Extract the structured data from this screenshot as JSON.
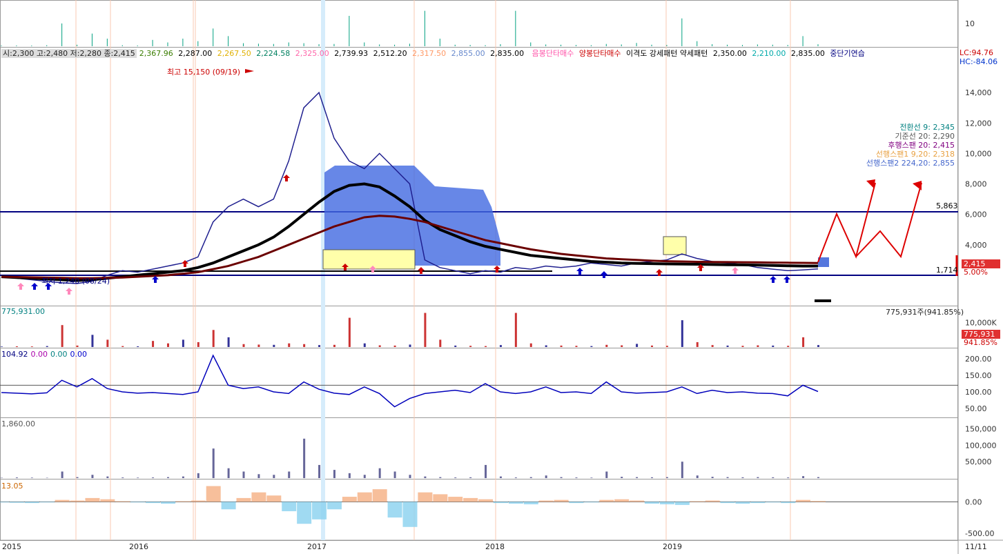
{
  "main_header": {
    "ohlc": "시:2,300 고:2,480 저:2,280 종:2,415",
    "ma_values": [
      {
        "text": "2,367.96",
        "color": "#3a7d00"
      },
      {
        "text": "2,287.00",
        "color": "#000000"
      },
      {
        "text": "2,267.50",
        "color": "#e0b000"
      },
      {
        "text": "2,224.58",
        "color": "#008060"
      },
      {
        "text": "2,325.00",
        "color": "#ff66aa"
      },
      {
        "text": "2,739.93",
        "color": "#000000"
      },
      {
        "text": "2,512.20",
        "color": "#000000"
      },
      {
        "text": "2,317.50",
        "color": "#ff9966"
      },
      {
        "text": "2,855.00",
        "color": "#6688cc"
      },
      {
        "text": "2,835.00",
        "color": "#000000"
      }
    ],
    "signals": [
      {
        "text": "음봉단타매수",
        "color": "#ff55aa"
      },
      {
        "text": "양봉단타매수",
        "color": "#cc0000"
      },
      {
        "text": "이격도 강세패턴 약세패턴",
        "color": "#000000"
      },
      {
        "text": "2,350.00",
        "color": "#000000"
      },
      {
        "text": "2,210.00",
        "color": "#00aaaa"
      },
      {
        "text": "2,835.00",
        "color": "#000000"
      },
      {
        "text": "중단기연습",
        "color": "#000080"
      }
    ],
    "lc": "LC:94.76",
    "hc": "HC:-84.06"
  },
  "annotations": {
    "high": "최고 15,150 (09/19)",
    "low": "최저 1,240 (08/24)",
    "line_upper": "5,863",
    "line_lower": "1,714",
    "last_price": "2,415",
    "pct": "5.00%"
  },
  "ichimoku_legend": [
    {
      "text": "전환선 9: 2,345",
      "color": "#008080"
    },
    {
      "text": "기준선 20: 2,290",
      "color": "#555555"
    },
    {
      "text": "후행스팬 20: 2,415",
      "color": "#800080"
    },
    {
      "text": "선행스팬1 9,20: 2,318",
      "color": "#e8a040"
    },
    {
      "text": "선행스팬2 224,20: 2,855",
      "color": "#4466cc"
    }
  ],
  "volume_panel": {
    "label": "775,931.00",
    "right_label": "775,931주(941.85%)",
    "tag_value": "775,931",
    "tag_pct": "941.85%"
  },
  "disparity_panel": {
    "label_a": "104.92",
    "label_b": "0.00",
    "label_c": "0.00",
    "label_d": "0.00"
  },
  "amount_panel": {
    "label": "1,860.00"
  },
  "osc_panel": {
    "label": "13.05"
  },
  "x_axis": {
    "labels": [
      "2015",
      "2016",
      "2017",
      "2018",
      "2019",
      "11/11"
    ]
  },
  "colors": {
    "cloud": "#4169e1",
    "price_line": "#1f1f8f",
    "ma_long": "#000000",
    "ma_vlong": "#6b0000",
    "hline": "#000080",
    "up": "#cc0000",
    "down": "#0000cc"
  },
  "chart_data": [
    {
      "type": "line",
      "title": "",
      "ylim": [
        0,
        16000
      ],
      "y_ticks": [
        4000,
        6000,
        8000,
        10000,
        12000,
        14000
      ],
      "y_tick_labels": [
        "4,000",
        "6,000",
        "8,000",
        "10,000",
        "12,000",
        "14,000"
      ],
      "x_labels": [
        "2015",
        "2016",
        "2017",
        "2018",
        "2019"
      ],
      "series": [
        {
          "values": [
            1900,
            1800,
            1700,
            1600,
            1500,
            1450,
            1600,
            2000,
            2300,
            2200,
            2400,
            2600,
            2800,
            3200,
            5500,
            6500,
            7000,
            6500,
            7000,
            9500,
            13000,
            14000,
            11000,
            9500,
            9000,
            10000,
            9000,
            8000,
            3000,
            2500,
            2300,
            2100,
            2300,
            2200,
            2500,
            2400,
            2600,
            2500,
            2600,
            2800,
            2700,
            2600,
            2800,
            2900,
            3000,
            3400,
            3100,
            2900,
            2800,
            2700,
            2500,
            2400,
            2300,
            2350,
            2415
          ]
        },
        {
          "values": [
            1900,
            1850,
            1800,
            1750,
            1700,
            1650,
            1700,
            1800,
            1900,
            2000,
            2100,
            2200,
            2300,
            2500,
            2800,
            3200,
            3600,
            4000,
            4500,
            5200,
            6000,
            6800,
            7500,
            7900,
            8000,
            7800,
            7200,
            6500,
            5600,
            5000,
            4600,
            4200,
            3900,
            3700,
            3500,
            3300,
            3200,
            3100,
            3000,
            2900,
            2850,
            2800,
            2780,
            2760,
            2740,
            2730,
            2720,
            2700,
            2690,
            2680,
            2660,
            2640,
            2620,
            2600,
            2600
          ]
        },
        {
          "values": [
            1900,
            1880,
            1860,
            1840,
            1820,
            1800,
            1800,
            1820,
            1850,
            1900,
            1950,
            2000,
            2100,
            2200,
            2400,
            2600,
            2900,
            3200,
            3600,
            4000,
            4400,
            4800,
            5200,
            5500,
            5800,
            5900,
            5850,
            5700,
            5500,
            5200,
            4900,
            4600,
            4300,
            4100,
            3900,
            3700,
            3550,
            3400,
            3300,
            3200,
            3100,
            3050,
            3000,
            2950,
            2920,
            2900,
            2880,
            2870,
            2860,
            2850,
            2840,
            2830,
            2820,
            2810,
            2800
          ]
        }
      ]
    },
    {
      "type": "bar",
      "title": "",
      "ylim": [
        0,
        15000
      ],
      "y_ticks": [
        10000
      ],
      "y_tick_labels": [
        "10,000K"
      ],
      "values": [
        200,
        300,
        250,
        400,
        9000,
        600,
        5000,
        3000,
        400,
        300,
        2500,
        1500,
        3000,
        2000,
        7000,
        4000,
        1200,
        1000,
        900,
        1500,
        1200,
        800,
        900,
        12000,
        1500,
        700,
        600,
        1000,
        14000,
        3000,
        600,
        500,
        400,
        800,
        14000,
        1500,
        700,
        600,
        500,
        400,
        900,
        700,
        1300,
        600,
        500,
        11000,
        2000,
        800,
        600,
        500,
        700,
        600,
        500,
        4000,
        800
      ]
    },
    {
      "type": "line",
      "title": "",
      "ylim": [
        25,
        225
      ],
      "y_ticks": [
        50,
        100,
        150,
        200
      ],
      "y_tick_labels": [
        "50.00",
        "100.00",
        "150.00",
        "200.00"
      ],
      "hline": 120,
      "values": [
        98,
        96,
        94,
        97,
        135,
        115,
        140,
        110,
        100,
        96,
        98,
        95,
        92,
        100,
        210,
        120,
        110,
        115,
        100,
        95,
        130,
        108,
        96,
        92,
        115,
        95,
        55,
        80,
        95,
        100,
        105,
        98,
        125,
        100,
        95,
        100,
        115,
        98,
        100,
        95,
        130,
        100,
        96,
        98,
        100,
        115,
        95,
        105,
        98,
        100,
        96,
        95,
        88,
        120,
        101
      ]
    },
    {
      "type": "bar",
      "title": "",
      "ylim": [
        0,
        170000
      ],
      "y_ticks": [
        50000,
        100000,
        150000
      ],
      "y_tick_labels": [
        "50,000",
        "100,000",
        "150,000"
      ],
      "values": [
        1000,
        2000,
        1500,
        1000,
        20000,
        3000,
        10000,
        5000,
        2000,
        1500,
        2000,
        3000,
        5000,
        15000,
        90000,
        30000,
        20000,
        12000,
        10000,
        20000,
        120000,
        40000,
        25000,
        15000,
        10000,
        30000,
        20000,
        10000,
        5000,
        3000,
        2000,
        2500,
        40000,
        5000,
        2000,
        3000,
        8000,
        3000,
        2000,
        1500,
        20000,
        4000,
        3000,
        2500,
        3000,
        50000,
        8000,
        4000,
        3000,
        2500,
        3000,
        2500,
        2000,
        6000,
        3000
      ]
    },
    {
      "type": "area",
      "title": "",
      "ylim": [
        -600,
        300
      ],
      "y_ticks": [
        -500,
        0
      ],
      "y_tick_labels": [
        "-500.00",
        "0.00"
      ],
      "values": [
        -10,
        -15,
        -20,
        -10,
        30,
        20,
        60,
        40,
        10,
        -10,
        -20,
        -30,
        10,
        20,
        250,
        -120,
        60,
        150,
        100,
        -150,
        -350,
        -280,
        -120,
        80,
        150,
        200,
        -250,
        -400,
        150,
        120,
        80,
        60,
        40,
        -20,
        -30,
        -40,
        20,
        30,
        -20,
        -10,
        30,
        40,
        20,
        -30,
        -40,
        -50,
        10,
        20,
        -20,
        -30,
        -20,
        -10,
        -20,
        30,
        13
      ]
    }
  ]
}
